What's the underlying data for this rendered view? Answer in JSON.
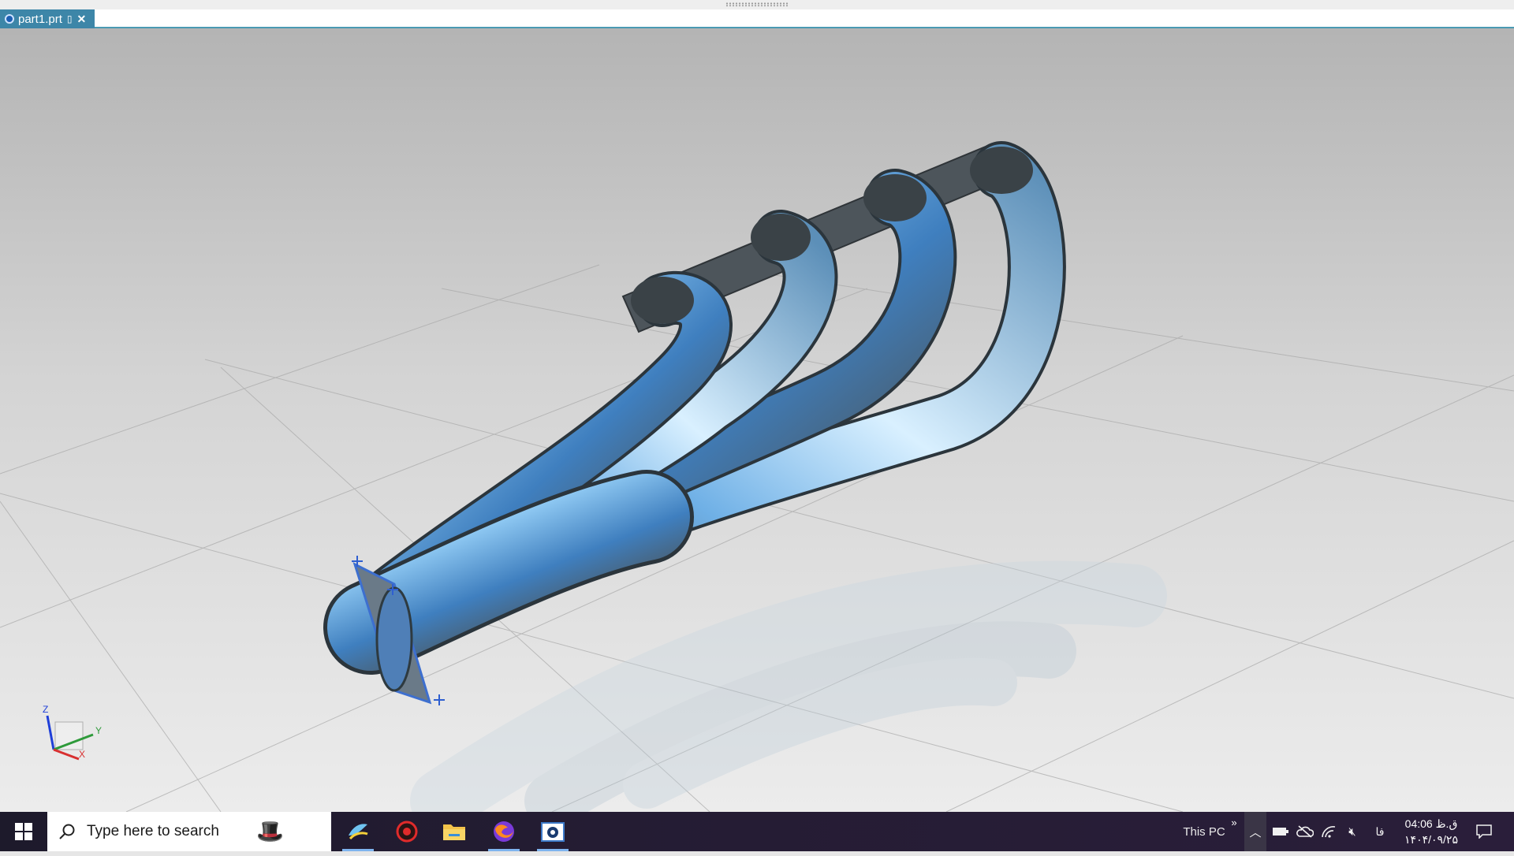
{
  "document_tab": {
    "title": "part1.prt"
  },
  "viewport": {
    "triad_labels": {
      "z": "Z",
      "y": "Y",
      "x": "X"
    }
  },
  "taskbar": {
    "search_placeholder": "Type here to search",
    "tray_location_label": "This PC",
    "overflow_glyph": "»",
    "language_indicator": "فا",
    "clock_time": "04:06 ق.ظ",
    "clock_date": "۱۴۰۴/۰۹/۲۵"
  }
}
